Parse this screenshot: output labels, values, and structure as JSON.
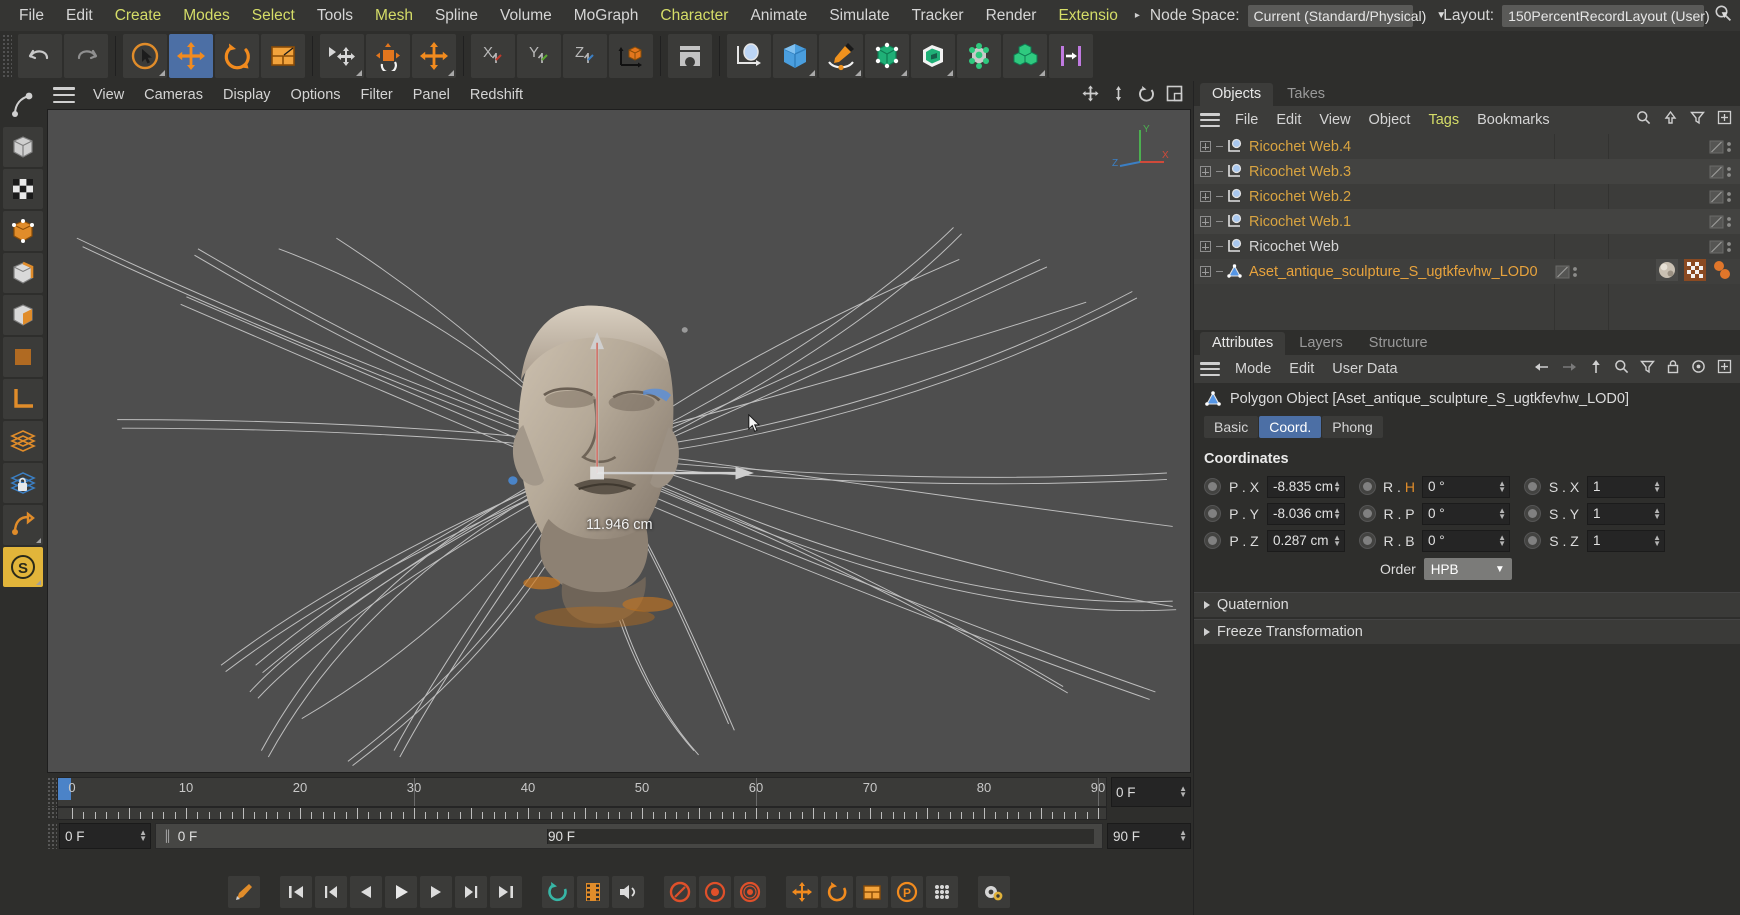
{
  "menubar": {
    "items": [
      {
        "label": "File",
        "highlight": false
      },
      {
        "label": "Edit",
        "highlight": false
      },
      {
        "label": "Create",
        "highlight": true
      },
      {
        "label": "Modes",
        "highlight": true
      },
      {
        "label": "Select",
        "highlight": true
      },
      {
        "label": "Tools",
        "highlight": false
      },
      {
        "label": "Mesh",
        "highlight": true
      },
      {
        "label": "Spline",
        "highlight": false
      },
      {
        "label": "Volume",
        "highlight": false
      },
      {
        "label": "MoGraph",
        "highlight": false
      },
      {
        "label": "Character",
        "highlight": true
      },
      {
        "label": "Animate",
        "highlight": false
      },
      {
        "label": "Simulate",
        "highlight": false
      },
      {
        "label": "Tracker",
        "highlight": false
      },
      {
        "label": "Render",
        "highlight": false
      },
      {
        "label": "Extensio",
        "highlight": true
      }
    ],
    "overflow_arrow": "▸",
    "node_space_label": "Node Space:",
    "node_space_value": "Current (Standard/Physical)",
    "layout_label": "Layout:",
    "layout_value": "150PercentRecordLayout (User)",
    "search_icon": "search-icon"
  },
  "toolbar": {
    "undo": "undo-icon",
    "redo": "redo-icon",
    "tools": [
      {
        "name": "live-selection-tool",
        "selected": false,
        "corner": true
      },
      {
        "name": "move-tool",
        "selected": true,
        "corner": false
      },
      {
        "name": "rotate-tool",
        "selected": false,
        "corner": false
      },
      {
        "name": "scale-tool",
        "selected": false,
        "corner": false
      },
      {
        "name": "world-object-axis-tool",
        "selected": false,
        "corner": true
      },
      {
        "name": "object-axis-tool",
        "selected": false,
        "corner": false
      },
      {
        "name": "move-axis-tool",
        "selected": false,
        "corner": true
      },
      {
        "name": "lock-x-axis",
        "selected": false,
        "corner": false
      },
      {
        "name": "lock-y-axis",
        "selected": false,
        "corner": false
      },
      {
        "name": "lock-z-axis",
        "selected": false,
        "corner": false
      },
      {
        "name": "world-coordinate-system",
        "selected": false,
        "corner": false
      },
      {
        "name": "render-view-icon",
        "selected": false,
        "corner": false
      },
      {
        "name": "render-picture-viewer",
        "selected": false,
        "corner": false
      },
      {
        "name": "render-settings",
        "selected": false,
        "corner": true
      },
      {
        "name": "spline-pen-tool",
        "selected": false,
        "corner": true
      },
      {
        "name": "cube-primitive",
        "selected": false,
        "corner": true
      },
      {
        "name": "spline-primitive",
        "selected": false,
        "corner": true
      },
      {
        "name": "generator-object",
        "selected": false,
        "corner": true
      },
      {
        "name": "array-object",
        "selected": false,
        "corner": true
      },
      {
        "name": "deformer-object",
        "selected": false,
        "corner": false
      }
    ]
  },
  "leftbar": {
    "items": [
      {
        "name": "make-editable-icon",
        "corner": false
      },
      {
        "name": "model-mode-icon",
        "corner": false
      },
      {
        "name": "texture-mode-icon",
        "corner": false
      },
      {
        "name": "point-mode-icon",
        "corner": false
      },
      {
        "name": "edge-mode-icon",
        "corner": false
      },
      {
        "name": "polygon-mode-icon",
        "corner": false
      },
      {
        "name": "viewport-solo-icon",
        "corner": false
      },
      {
        "name": "workplane-icon",
        "corner": false
      },
      {
        "name": "enable-axis-icon",
        "corner": false
      },
      {
        "name": "lock-workplane-icon",
        "corner": false
      },
      {
        "name": "snap-icon",
        "corner": true
      },
      {
        "name": "snap-settings-icon",
        "corner": true
      }
    ]
  },
  "viewport": {
    "menu": [
      "View",
      "Cameras",
      "Display",
      "Options",
      "Filter",
      "Panel",
      "Redshift"
    ],
    "hamburger": "hamburger-icon",
    "corner_icons": [
      "pan-view-icon",
      "zoom-view-icon",
      "rotate-view-icon",
      "maximize-view-icon"
    ],
    "axis_labels": {
      "x": "X",
      "y": "Y",
      "z": "Z"
    },
    "measurement_label": "11.946 cm"
  },
  "timeline": {
    "ticks": [
      "0",
      "10",
      "20",
      "30",
      "40",
      "50",
      "60",
      "70",
      "80",
      "90"
    ],
    "start_frame_field": "0 F",
    "current_frame_field": "0 F",
    "range_start": "0 F",
    "range_end": "90 F",
    "range_field": "90 F",
    "playhead_frame": 0
  },
  "transport": {
    "buttons": [
      {
        "name": "record-active-objects-icon",
        "accent": "orange"
      },
      {
        "name": "go-to-start-icon",
        "accent": "plain"
      },
      {
        "name": "go-to-previous-key-icon",
        "accent": "plain"
      },
      {
        "name": "step-back-icon",
        "accent": "plain"
      },
      {
        "name": "play-icon",
        "accent": "plain"
      },
      {
        "name": "step-forward-icon",
        "accent": "plain"
      },
      {
        "name": "go-to-next-key-icon",
        "accent": "plain"
      },
      {
        "name": "go-to-end-icon",
        "accent": "plain"
      },
      {
        "name": "loop-icon",
        "accent": "teal"
      },
      {
        "name": "filmstrip-icon",
        "accent": "orange"
      },
      {
        "name": "sound-icon",
        "accent": "plain"
      },
      {
        "name": "record-icon",
        "accent": "orange"
      },
      {
        "name": "autokeying-icon",
        "accent": "orange"
      },
      {
        "name": "keyframe-selection-icon",
        "accent": "orange"
      },
      {
        "name": "position-key-icon",
        "accent": "orange"
      },
      {
        "name": "rotation-key-icon",
        "accent": "orange"
      },
      {
        "name": "scale-key-icon",
        "accent": "orange"
      },
      {
        "name": "parameter-key-icon",
        "accent": "orange"
      },
      {
        "name": "point-level-animation-icon",
        "accent": "plain"
      },
      {
        "name": "project-settings-icon",
        "accent": "plain"
      }
    ]
  },
  "object_manager": {
    "tabs": [
      {
        "label": "Objects",
        "active": true
      },
      {
        "label": "Takes",
        "active": false
      }
    ],
    "menu": [
      {
        "label": "File",
        "highlight": false
      },
      {
        "label": "Edit",
        "highlight": false
      },
      {
        "label": "View",
        "highlight": false
      },
      {
        "label": "Object",
        "highlight": false
      },
      {
        "label": "Tags",
        "highlight": true
      },
      {
        "label": "Bookmarks",
        "highlight": false
      }
    ],
    "header_icons": [
      "search-icon",
      "up-arrow-icon",
      "filter-icon",
      "add-layer-icon"
    ],
    "objects": [
      {
        "name": "Ricochet Web.4",
        "icon": "spline-object-icon",
        "selected": false,
        "tags": []
      },
      {
        "name": "Ricochet Web.3",
        "icon": "spline-object-icon",
        "selected": false,
        "tags": []
      },
      {
        "name": "Ricochet Web.2",
        "icon": "spline-object-icon",
        "selected": false,
        "tags": []
      },
      {
        "name": "Ricochet Web.1",
        "icon": "spline-object-icon",
        "selected": false,
        "tags": []
      },
      {
        "name": "Ricochet Web",
        "icon": "spline-object-icon",
        "selected": false,
        "tags": []
      },
      {
        "name": "Aset_antique_sculpture_S_ugtkfevhw_LOD0",
        "icon": "polygon-object-icon",
        "selected": true,
        "tags": [
          "material-tag-icon",
          "uvw-tag-icon",
          "point-tag-icon"
        ]
      }
    ]
  },
  "attributes": {
    "tabs": [
      {
        "label": "Attributes",
        "active": true
      },
      {
        "label": "Layers",
        "active": false
      },
      {
        "label": "Structure",
        "active": false
      }
    ],
    "menu": [
      "Mode",
      "Edit",
      "User Data"
    ],
    "header_icons": [
      "back-arrow-icon",
      "forward-arrow-icon",
      "up-arrow-icon",
      "search-icon",
      "filter-icon",
      "lock-icon",
      "target-icon",
      "add-icon"
    ],
    "object_title": "Polygon Object [Aset_antique_sculpture_S_ugtkfevhw_LOD0]",
    "object_icon": "polygon-object-icon",
    "subtabs": [
      {
        "label": "Basic",
        "active": false
      },
      {
        "label": "Coord.",
        "active": true
      },
      {
        "label": "Phong",
        "active": false
      }
    ],
    "section_title": "Coordinates",
    "rows": [
      {
        "p_label": "P . X",
        "p_value": "-8.835 cm",
        "r_label": "R . H",
        "r_label_accent": "H",
        "r_value": "0 °",
        "s_label": "S . X",
        "s_value": "1"
      },
      {
        "p_label": "P . Y",
        "p_value": "-8.036 cm",
        "r_label": "R . P",
        "r_label_accent": "",
        "r_value": "0 °",
        "s_label": "S . Y",
        "s_value": "1"
      },
      {
        "p_label": "P . Z",
        "p_value": "0.287 cm",
        "r_label": "R . B",
        "r_label_accent": "",
        "r_value": "0 °",
        "s_label": "S . Z",
        "s_value": "1"
      }
    ],
    "order_label": "Order",
    "order_value": "HPB",
    "folds": [
      {
        "label": "Quaternion"
      },
      {
        "label": "Freeze Transformation"
      }
    ]
  },
  "colors": {
    "accent_orange": "#e08c2a",
    "selection_blue": "#4c6fa5",
    "menu_highlight": "#d5dd68",
    "object_name": "#d9a441",
    "panel_bg": "#2e2e2c",
    "viewport_bg": "#4e4e4e"
  }
}
